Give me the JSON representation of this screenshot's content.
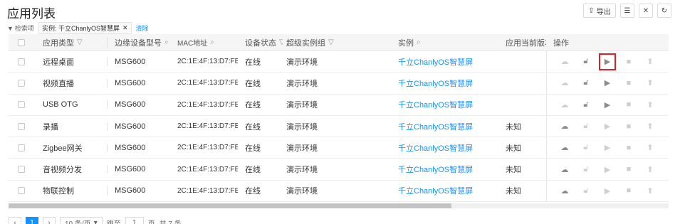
{
  "page": {
    "title": "应用列表"
  },
  "toolbar": {
    "export_label": "导出"
  },
  "filter": {
    "label": "检索项",
    "tag": "实例: 千立ChanlyOS智慧屏",
    "clear": "清除"
  },
  "columns": {
    "type": "应用类型",
    "model": "边缘设备型号",
    "mac": "MAC地址",
    "status": "设备状态",
    "group": "超级实例组",
    "instance": "实例",
    "version": "应用当前版本号",
    "ops": "操作"
  },
  "rows": [
    {
      "type": "远程桌面",
      "model": "MSG600",
      "mac": "2C:1E:4F:13:D7:FE",
      "status": "在线",
      "group": "演示环境",
      "instance": "千立ChanlyOS智慧屏",
      "version": ""
    },
    {
      "type": "视频直播",
      "model": "MSG600",
      "mac": "2C:1E:4F:13:D7:FE",
      "status": "在线",
      "group": "演示环境",
      "instance": "千立ChanlyOS智慧屏",
      "version": ""
    },
    {
      "type": "USB OTG",
      "model": "MSG600",
      "mac": "2C:1E:4F:13:D7:FE",
      "status": "在线",
      "group": "演示环境",
      "instance": "千立ChanlyOS智慧屏",
      "version": ""
    },
    {
      "type": "录播",
      "model": "MSG600",
      "mac": "2C:1E:4F:13:D7:FE",
      "status": "在线",
      "group": "演示环境",
      "instance": "千立ChanlyOS智慧屏",
      "version": "未知"
    },
    {
      "type": "Zigbee网关",
      "model": "MSG600",
      "mac": "2C:1E:4F:13:D7:FE",
      "status": "在线",
      "group": "演示环境",
      "instance": "千立ChanlyOS智慧屏",
      "version": "未知"
    },
    {
      "type": "音视频分发",
      "model": "MSG600",
      "mac": "2C:1E:4F:13:D7:FE",
      "status": "在线",
      "group": "演示环境",
      "instance": "千立ChanlyOS智慧屏",
      "version": "未知"
    },
    {
      "type": "物联控制",
      "model": "MSG600",
      "mac": "2C:1E:4F:13:D7:FE",
      "status": "在线",
      "group": "演示环境",
      "instance": "千立ChanlyOS智慧屏",
      "version": "未知"
    }
  ],
  "pagination": {
    "current": "1",
    "page_size": "10 条/页",
    "goto_label": "跳至",
    "goto_value": "1",
    "page_unit": "页",
    "total": "共 7 条"
  },
  "colors": {
    "accent": "#1890ff",
    "highlight": "#e02020"
  }
}
